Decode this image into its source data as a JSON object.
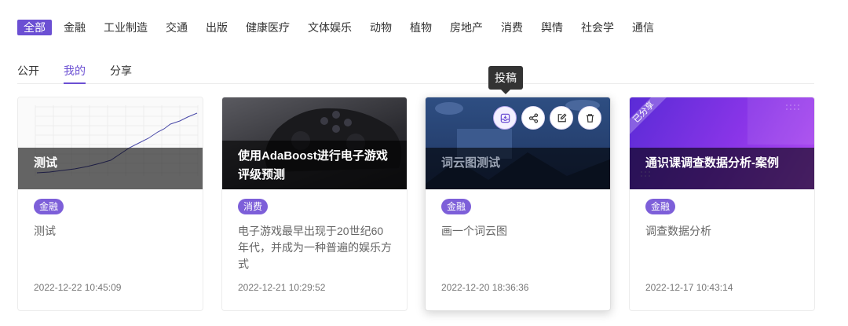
{
  "categories": [
    "全部",
    "金融",
    "工业制造",
    "交通",
    "出版",
    "健康医疗",
    "文体娱乐",
    "动物",
    "植物",
    "房地产",
    "消费",
    "舆情",
    "社会学",
    "通信"
  ],
  "tabs": [
    "公开",
    "我的",
    "分享"
  ],
  "tooltip": "投稿",
  "cards": [
    {
      "title": "测试",
      "tag": "金融",
      "desc": "测试",
      "date": "2022-12-22 10:45:09"
    },
    {
      "title": "使用AdaBoost进行电子游戏评级预测",
      "tag": "消费",
      "desc": "电子游戏最早出现于20世纪60年代，并成为一种普遍的娱乐方式",
      "date": "2022-12-21 10:29:52"
    },
    {
      "title": "词云图测试",
      "tag": "金融",
      "desc": "画一个词云图",
      "date": "2022-12-20 18:36:36"
    },
    {
      "title": "通识课调查数据分析-案例",
      "tag": "金融",
      "desc": "调查数据分析",
      "date": "2022-12-17 10:43:14",
      "ribbon": "已分享"
    }
  ],
  "colors": {
    "accent": "#6b4fd3",
    "tag": "#7d5fd9"
  }
}
